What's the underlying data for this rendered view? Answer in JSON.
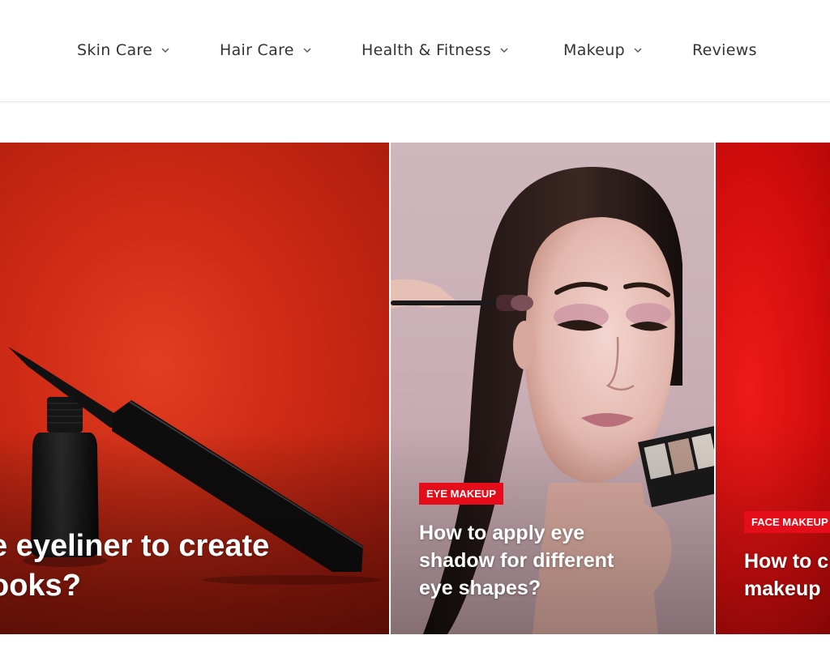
{
  "nav": {
    "items": [
      {
        "label": "Skin Care",
        "has_dropdown": true
      },
      {
        "label": "Hair Care",
        "has_dropdown": true
      },
      {
        "label": "Health & Fitness",
        "has_dropdown": true
      },
      {
        "label": "Makeup",
        "has_dropdown": true
      },
      {
        "label": "Reviews",
        "has_dropdown": false
      }
    ]
  },
  "colors": {
    "accent": "#e60d1b",
    "nav_text": "#333333"
  },
  "cards": [
    {
      "category": "",
      "title_lines": [
        "e eyeliner to create",
        "ooks?"
      ]
    },
    {
      "category": "Eye Makeup",
      "title_lines": [
        "How to apply eye",
        "shadow for different",
        "eye shapes?"
      ]
    },
    {
      "category": "Face Makeup",
      "title_lines": [
        "How to c",
        "makeup"
      ]
    }
  ]
}
